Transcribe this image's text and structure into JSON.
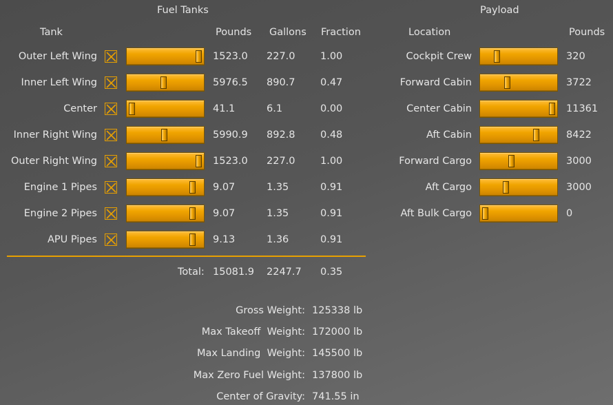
{
  "fuel": {
    "title": "Fuel Tanks",
    "headers": {
      "tank": "Tank",
      "pounds": "Pounds",
      "gallons": "Gallons",
      "fraction": "Fraction"
    },
    "tanks": [
      {
        "name": "Outer Left Wing",
        "pounds": "1523.0",
        "gallons": "227.0",
        "fraction": "1.00",
        "level": 1.0
      },
      {
        "name": "Inner Left Wing",
        "pounds": "5976.5",
        "gallons": "890.7",
        "fraction": "0.47",
        "level": 0.47
      },
      {
        "name": "Center",
        "pounds": "41.1",
        "gallons": "6.1",
        "fraction": "0.00",
        "level": 0.0
      },
      {
        "name": "Inner Right Wing",
        "pounds": "5990.9",
        "gallons": "892.8",
        "fraction": "0.48",
        "level": 0.48
      },
      {
        "name": "Outer Right Wing",
        "pounds": "1523.0",
        "gallons": "227.0",
        "fraction": "1.00",
        "level": 1.0
      },
      {
        "name": "Engine 1 Pipes",
        "pounds": "9.07",
        "gallons": "1.35",
        "fraction": "0.91",
        "level": 0.91
      },
      {
        "name": "Engine 2 Pipes",
        "pounds": "9.07",
        "gallons": "1.35",
        "fraction": "0.91",
        "level": 0.91
      },
      {
        "name": "APU Pipes",
        "pounds": "9.13",
        "gallons": "1.36",
        "fraction": "0.91",
        "level": 0.91
      }
    ],
    "total": {
      "label": "Total:",
      "pounds": "15081.9",
      "gallons": "2247.7",
      "fraction": "0.35"
    }
  },
  "payload": {
    "title": "Payload",
    "headers": {
      "location": "Location",
      "pounds": "Pounds"
    },
    "items": [
      {
        "name": "Cockpit Crew",
        "pounds": "320",
        "level": 0.18
      },
      {
        "name": "Forward Cabin",
        "pounds": "3722",
        "level": 0.33
      },
      {
        "name": "Center Cabin",
        "pounds": "11361",
        "level": 1.0
      },
      {
        "name": "Aft Cabin",
        "pounds": "8422",
        "level": 0.76
      },
      {
        "name": "Forward Cargo",
        "pounds": "3000",
        "level": 0.39
      },
      {
        "name": "Aft Cargo",
        "pounds": "3000",
        "level": 0.31
      },
      {
        "name": "Aft Bulk Cargo",
        "pounds": "0",
        "level": 0.0
      }
    ]
  },
  "summary": [
    {
      "label": "Gross Weight:",
      "value": "125338 lb"
    },
    {
      "label": "Max Takeoff  Weight:",
      "value": "172000 lb"
    },
    {
      "label": "Max Landing  Weight:",
      "value": "145500 lb"
    },
    {
      "label": "Max Zero Fuel Weight:",
      "value": "137800 lb"
    },
    {
      "label": "Center of Gravity:",
      "value": "741.55 in"
    }
  ]
}
